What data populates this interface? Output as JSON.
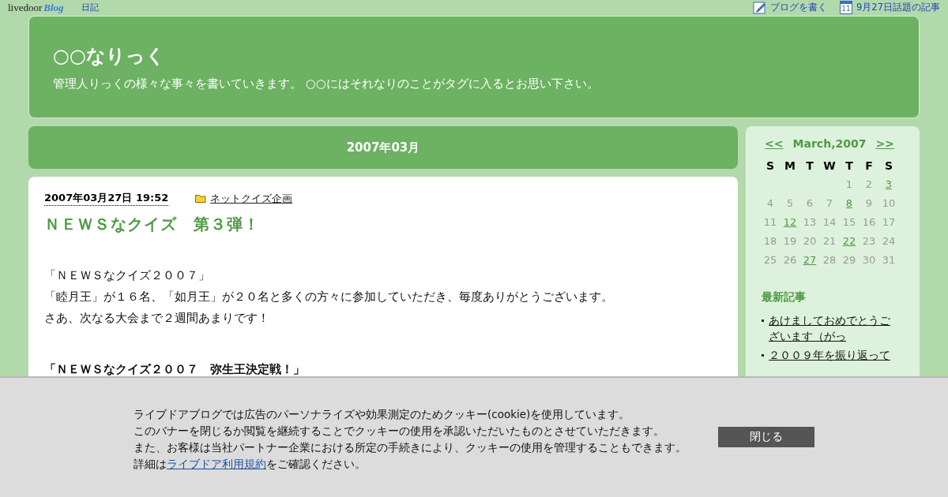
{
  "topbar": {
    "logo": "livedoor",
    "logo_sub": "Blog",
    "link": "日記",
    "actions": [
      {
        "kind": "write",
        "label": "ブログを書く"
      },
      {
        "kind": "calendar",
        "icon_text": "11",
        "label": "9月27日話題の記事"
      }
    ]
  },
  "header": {
    "title": "○○なりっく",
    "description": "管理人りっくの様々な事々を書いていきます。 ○○にはそれなりのことがタグに入るとお思い下さい。"
  },
  "month_title": "2007年03月",
  "post": {
    "date": "2007年03月27日 19:52",
    "category": "ネットクイズ企画",
    "title": "ＮＥＷＳなクイズ　第３弾！",
    "paragraphs": [
      {
        "kind": "gap"
      },
      {
        "kind": "text",
        "lines": [
          "「ＮＥＷＳなクイズ２００７」",
          "「睦月王」が１６名、「如月王」が２０名と多くの方々に参加していただき、毎度ありがとうございます。",
          "さあ、次なる大会まで２週間あまりです！"
        ]
      },
      {
        "kind": "gap"
      },
      {
        "kind": "bold",
        "lines": [
          "「ＮＥＷＳなクイズ２００７　弥生王決定戦！」"
        ]
      }
    ]
  },
  "calendar": {
    "prev": "<<",
    "month": "March,2007",
    "next": ">>",
    "weekdays": [
      "S",
      "M",
      "T",
      "W",
      "T",
      "F",
      "S"
    ],
    "weeks": [
      [
        {
          "kind": "blank"
        },
        {
          "kind": "blank"
        },
        {
          "kind": "blank"
        },
        {
          "kind": "blank"
        },
        {
          "day": "1",
          "linked": false
        },
        {
          "day": "2",
          "linked": false
        },
        {
          "day": "3",
          "linked": true
        }
      ],
      [
        {
          "day": "4",
          "linked": false
        },
        {
          "day": "5",
          "linked": false
        },
        {
          "day": "6",
          "linked": false
        },
        {
          "day": "7",
          "linked": false
        },
        {
          "day": "8",
          "linked": true
        },
        {
          "day": "9",
          "linked": false
        },
        {
          "day": "10",
          "linked": false
        }
      ],
      [
        {
          "day": "11",
          "linked": false
        },
        {
          "day": "12",
          "linked": true
        },
        {
          "day": "13",
          "linked": false
        },
        {
          "day": "14",
          "linked": false
        },
        {
          "day": "15",
          "linked": false
        },
        {
          "day": "16",
          "linked": false
        },
        {
          "day": "17",
          "linked": false
        }
      ],
      [
        {
          "day": "18",
          "linked": false
        },
        {
          "day": "19",
          "linked": false
        },
        {
          "day": "20",
          "linked": false
        },
        {
          "day": "21",
          "linked": false
        },
        {
          "day": "22",
          "linked": true
        },
        {
          "day": "23",
          "linked": false
        },
        {
          "day": "24",
          "linked": false
        }
      ],
      [
        {
          "day": "25",
          "linked": false
        },
        {
          "day": "26",
          "linked": false
        },
        {
          "day": "27",
          "linked": true
        },
        {
          "day": "28",
          "linked": false
        },
        {
          "day": "29",
          "linked": false
        },
        {
          "day": "30",
          "linked": false
        },
        {
          "day": "31",
          "linked": false
        }
      ]
    ]
  },
  "recent": {
    "title": "最新記事",
    "items": [
      "あけましておめでとうございます（がっ",
      "２００９年を振り返って"
    ]
  },
  "cookie_banner": {
    "lines": [
      "ライブドアブログでは広告のパーソナライズや効果測定のためクッキー(cookie)を使用しています。",
      "このバナーを閉じるか閲覧を継続することでクッキーの使用を承認いただいたものとさせていただきます。",
      "また、お客様は当社パートナー企業における所定の手続きにより、クッキーの使用を管理することもできます。"
    ],
    "last_line": {
      "before": "詳細は",
      "link": "ライブドア利用規約",
      "after": "をご確認ください。"
    },
    "button": "閉じる"
  }
}
